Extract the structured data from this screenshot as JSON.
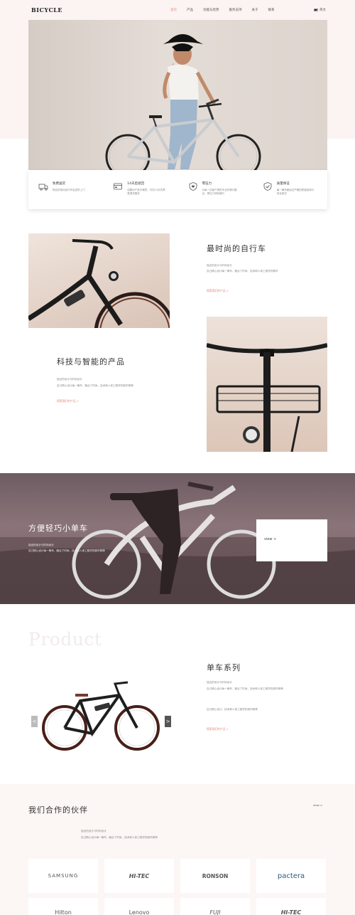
{
  "header": {
    "logo": "BICYCLE",
    "nav": [
      "首页",
      "产品",
      "功能与优势",
      "服务支持",
      "关于",
      "联系"
    ],
    "lang": "英文"
  },
  "features": [
    {
      "title": "免费送货",
      "desc": "购买的电动自行车后送货上门",
      "icon": "truck-icon"
    },
    {
      "title": "14天后退回",
      "desc": "如果对产品不满意，可在14天内享受退货服务",
      "icon": "wallet-icon"
    },
    {
      "title": "零压力",
      "desc": "为每一位客户提供专业的骑行建议，零压力体验骑行",
      "icon": "shield-heart-icon"
    },
    {
      "title": "质量保证",
      "desc": "每一辆车都经过严格的质量检测与安全测试",
      "icon": "shield-check-icon"
    }
  ],
  "section_fashion": {
    "title": "最时尚的自行车",
    "text1": "独出的设计与时尚设计",
    "text2": "自己精心设计每一辆车，融合了时尚、技术和人体工程学的精华",
    "link": "探索我们的产品 >"
  },
  "section_tech": {
    "title": "科技与智能的产品",
    "text1": "独出的设计与时尚设计",
    "text2": "自己精心设计每一辆车，融合了时尚、技术和人体工程学的城市精神",
    "link": "探索我们的产品 >"
  },
  "banner": {
    "title": "方便轻巧小单车",
    "text1": "独出的设计与时尚设计",
    "text2": "自己精心设计每一辆车，融合了时尚、技术和人体工程学的城市精神",
    "view": "view >"
  },
  "product": {
    "watermark": "Product",
    "title": "单车系列",
    "text1": "独出的设计与时尚设计",
    "text2": "自己精心设计每一辆车，融合了时尚、技术和人体工程学的城市精神",
    "text3": "自己精心设计，技术和人体工程学的城市精神",
    "link": "探索我们的产品 >",
    "prev": "<",
    "next": ">"
  },
  "partners": {
    "title": "我们合作的伙伴",
    "view": "view >",
    "text1": "独出的设计与时尚设计",
    "text2": "自己精心设计每一辆车，融合了时尚、技术和人体工程学的城市精神",
    "logos": [
      "SAMSUNG",
      "HI-TEC",
      "RONSON",
      "pactera",
      "Hilton",
      "Lenovo",
      "FUJI",
      "HI-TEC"
    ]
  },
  "colors": {
    "accent": "#e08a7d",
    "band": "#fbf4f3"
  }
}
